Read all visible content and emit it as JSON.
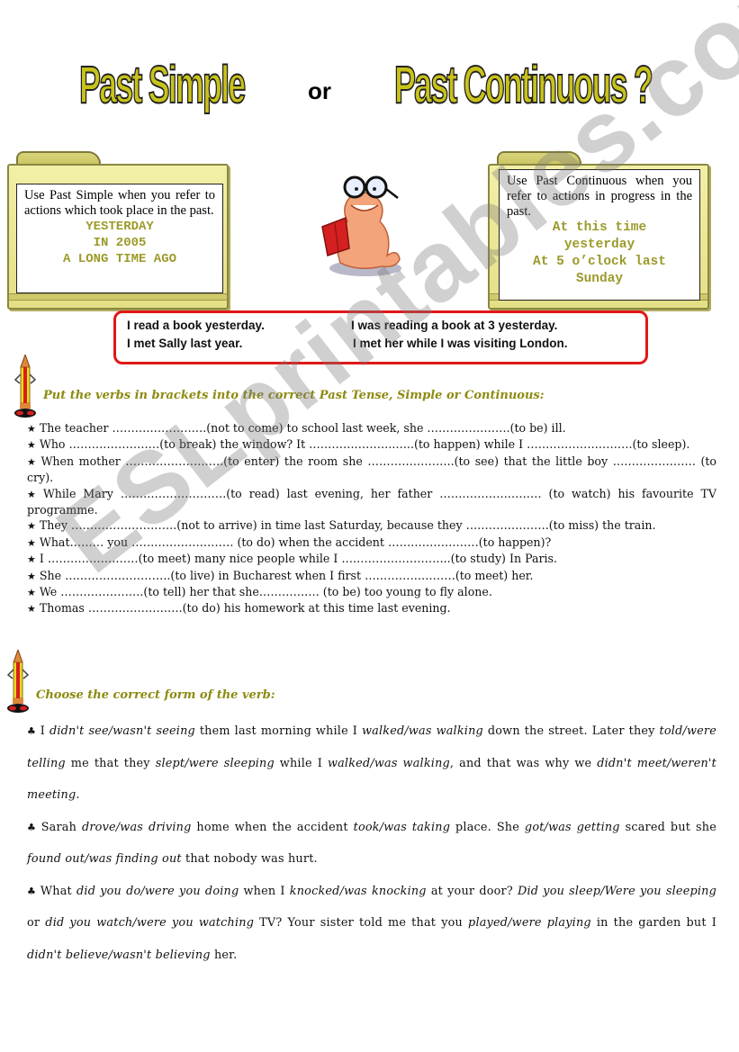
{
  "header": {
    "title_left": "Past Simple",
    "title_or": "or",
    "title_right": "Past Continuous ?"
  },
  "folders": {
    "left": {
      "description": "Use Past Simple when you refer to actions which took place in the past.",
      "keywords": [
        "YESTERDAY",
        "IN 2005",
        "A LONG TIME AGO"
      ]
    },
    "right": {
      "description": "Use Past Continuous when you refer to actions in progress in the past.",
      "keywords": [
        "At this time",
        "yesterday",
        "At 5 o’clock last",
        "Sunday"
      ]
    }
  },
  "examples": {
    "simple": [
      "I read a book yesterday.",
      "I met Sally last year."
    ],
    "continuous": [
      "I was reading a book at 3 yesterday.",
      "I met her while I was visiting London."
    ]
  },
  "exercise1": {
    "instruction": "Put the verbs in brackets into the correct Past Tense, Simple or Continuous:",
    "bullet": "★",
    "items": [
      "The teacher …………………….(not to come) to school last week, she ………………….(to be) ill.",
      "Who ……………………(to break) the window? It …………………..…..(to happen) while I ……………………….(to sleep).",
      "When mother ……………………..(to enter) the room she …………………..(to see) that the little boy …………………. (to cry).",
      "While Mary ……………………….(to read) last evening, her father ……………………… (to watch) his favourite TV programme.",
      "They ……………………….(not to arrive) in time last Saturday, because they ………………….(to miss) the train.",
      "What……… you ……………………… (to do) when the accident ……………………(to happen)?",
      "I ……………………(to meet) many nice people while I ………………………..(to study) In Paris.",
      "She ……………………….(to live) in Bucharest when I first ……………………(to meet) her.",
      "We ………………….(to tell) her that she……………. (to be) too young to fly alone.",
      "Thomas …………………….(to do) his homework at this time last evening."
    ]
  },
  "exercise2": {
    "instruction": "Choose the correct form of the verb:",
    "bullet": "♣",
    "paragraphs": [
      [
        {
          "t": "I "
        },
        {
          "t": "didn't see/wasn't seeing",
          "i": true
        },
        {
          "t": " them last morning while I "
        },
        {
          "t": "walked/was walking",
          "i": true
        },
        {
          "t": " down the street. Later they "
        },
        {
          "t": "told/were telling",
          "i": true
        },
        {
          "t": " me that they "
        },
        {
          "t": "slept/were sleeping",
          "i": true
        },
        {
          "t": " while I "
        },
        {
          "t": "walked/was walking",
          "i": true
        },
        {
          "t": ", and that was why we "
        },
        {
          "t": "didn't meet/weren't meeting.",
          "i": true
        }
      ],
      [
        {
          "t": "Sarah "
        },
        {
          "t": "drove/was driving",
          "i": true
        },
        {
          "t": " home when the accident "
        },
        {
          "t": "took/was taking",
          "i": true
        },
        {
          "t": " place. She "
        },
        {
          "t": "got/was getting",
          "i": true
        },
        {
          "t": " scared but she "
        },
        {
          "t": "found out/was finding out",
          "i": true
        },
        {
          "t": " that nobody was hurt."
        }
      ],
      [
        {
          "t": "What "
        },
        {
          "t": "did you do/were you doing",
          "i": true
        },
        {
          "t": " when I "
        },
        {
          "t": "knocked/was knocking",
          "i": true
        },
        {
          "t": " at your door? "
        },
        {
          "t": "Did you sleep/Were you sleeping",
          "i": true
        },
        {
          "t": " or "
        },
        {
          "t": "did you watch/were you watching",
          "i": true
        },
        {
          "t": " TV? Your sister told me that you "
        },
        {
          "t": "played/were playing",
          "i": true
        },
        {
          "t": " in the garden but I "
        },
        {
          "t": "didn't believe/wasn't believing",
          "i": true
        },
        {
          "t": " her."
        }
      ]
    ]
  },
  "watermark": "ESLprintables.com",
  "colors": {
    "title_fill": "#c8c21a",
    "keyword": "#9c9a2a",
    "instruction": "#8d8a10",
    "example_border": "#e01818"
  }
}
